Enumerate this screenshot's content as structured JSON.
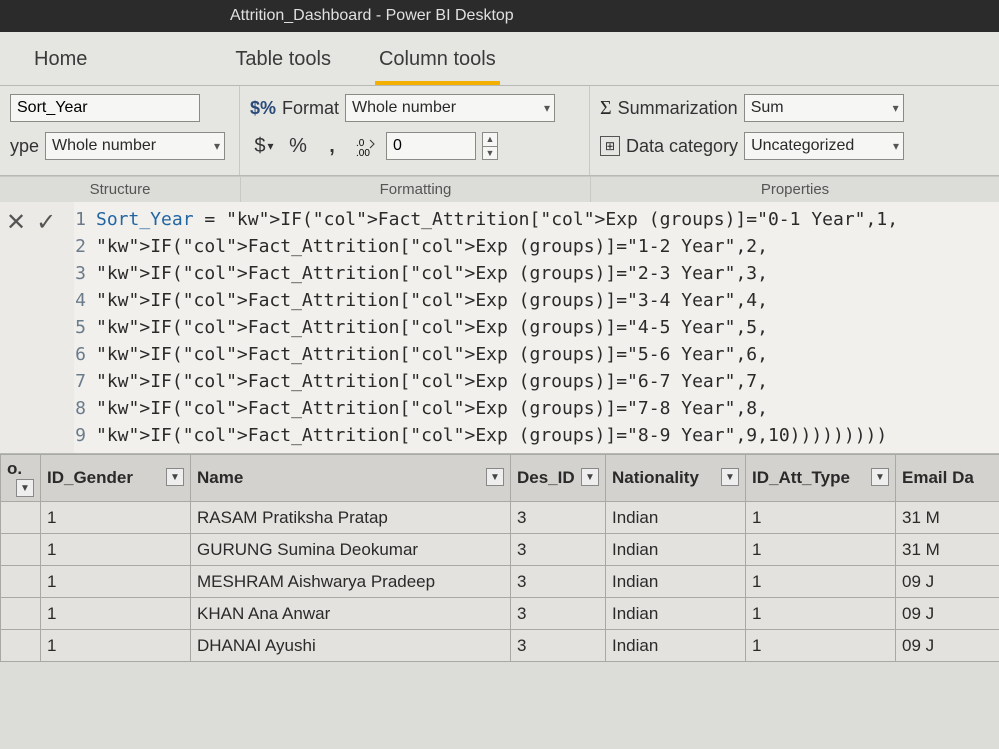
{
  "title": "Attrition_Dashboard - Power BI Desktop",
  "tabs": {
    "home": "Home",
    "table_tools": "Table tools",
    "column_tools": "Column tools"
  },
  "structure": {
    "name_value": "Sort_Year",
    "type_label_prefix": "ype",
    "type_value": "Whole number",
    "caption": "Structure"
  },
  "formatting": {
    "format_label": "Format",
    "format_value": "Whole number",
    "currency": "$",
    "percent": "%",
    "thousands": ",",
    "decimals_value": "0",
    "caption": "Formatting",
    "percent_icon": "$%"
  },
  "properties": {
    "summarization_label": "Summarization",
    "summarization_value": "Sum",
    "category_label": "Data category",
    "category_value": "Uncategorized",
    "caption": "Properties"
  },
  "formula": [
    "Sort_Year = IF(Fact_Attrition[Exp (groups)]=\"0-1 Year\",1,",
    "IF(Fact_Attrition[Exp (groups)]=\"1-2 Year\",2,",
    "IF(Fact_Attrition[Exp (groups)]=\"2-3 Year\",3,",
    "IF(Fact_Attrition[Exp (groups)]=\"3-4 Year\",4,",
    "IF(Fact_Attrition[Exp (groups)]=\"4-5 Year\",5,",
    "IF(Fact_Attrition[Exp (groups)]=\"5-6 Year\",6,",
    "IF(Fact_Attrition[Exp (groups)]=\"6-7 Year\",7,",
    "IF(Fact_Attrition[Exp (groups)]=\"7-8 Year\",8,",
    "IF(Fact_Attrition[Exp (groups)]=\"8-9 Year\",9,10)))))))))"
  ],
  "table": {
    "headers": {
      "c0": "o.",
      "c1": "ID_Gender",
      "c2": "Name",
      "c3": "Des_ID",
      "c4": "Nationality",
      "c5": "ID_Att_Type",
      "c6": "Email Da"
    },
    "rows": [
      {
        "gender": "1",
        "name": "RASAM Pratiksha Pratap",
        "des": "3",
        "nat": "Indian",
        "att": "1",
        "email": "31 M"
      },
      {
        "gender": "1",
        "name": "GURUNG Sumina Deokumar",
        "des": "3",
        "nat": "Indian",
        "att": "1",
        "email": "31 M"
      },
      {
        "gender": "1",
        "name": "MESHRAM Aishwarya Pradeep",
        "des": "3",
        "nat": "Indian",
        "att": "1",
        "email": "09 J"
      },
      {
        "gender": "1",
        "name": "KHAN Ana Anwar",
        "des": "3",
        "nat": "Indian",
        "att": "1",
        "email": "09 J"
      },
      {
        "gender": "1",
        "name": "DHANAI Ayushi",
        "des": "3",
        "nat": "Indian",
        "att": "1",
        "email": "09 J"
      }
    ]
  }
}
